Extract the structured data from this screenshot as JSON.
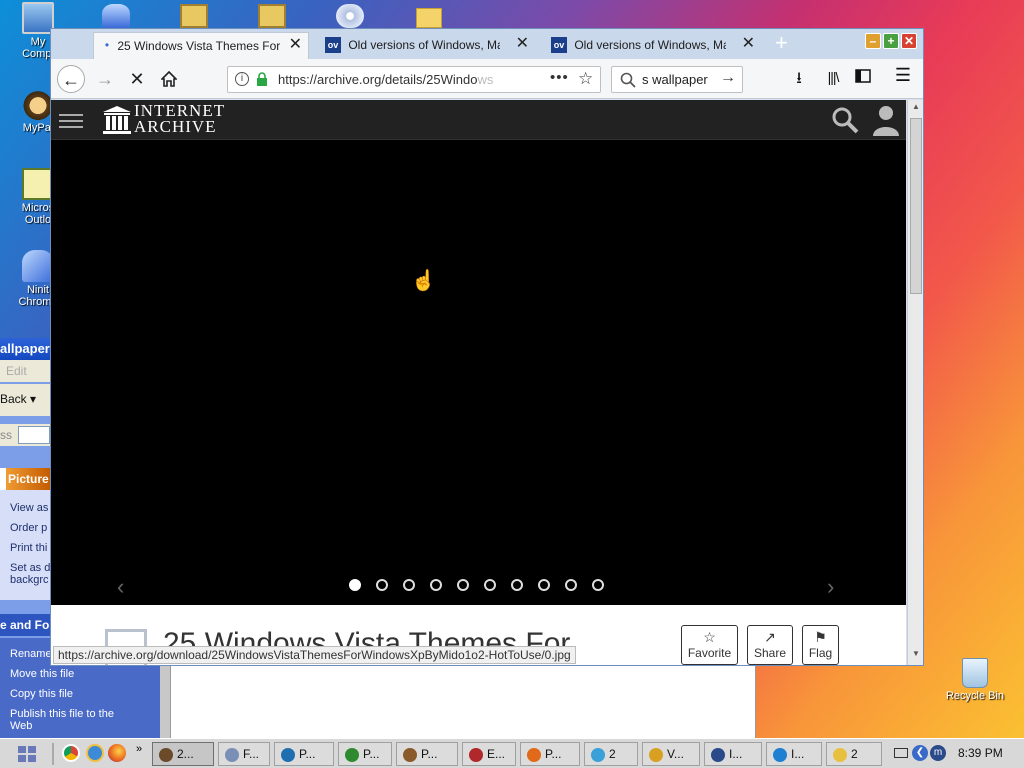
{
  "desktop": {
    "icons": [
      {
        "label": "My Compi",
        "name": "my-computer"
      },
      {
        "label": "MyPal",
        "name": "mypal"
      },
      {
        "label": "Micros Outlo",
        "name": "microsoft-outlook"
      },
      {
        "label": "Ninit Chrome",
        "name": "ninite-chrome"
      }
    ],
    "recycle_bin": "Recycle Bin"
  },
  "explorer": {
    "title": "allpaper",
    "menu_edit": "Edit",
    "back_label": "Back",
    "address_label": "ss",
    "picture_tasks_header": "Picture",
    "picture_tasks": [
      "View as",
      "Order p",
      "Print thi",
      "Set as d",
      "backgrc"
    ],
    "file_tasks_header": "e and Fo",
    "file_tasks": [
      "Rename",
      "Move this file",
      "Copy this file",
      "Publish this file to the",
      "Web"
    ]
  },
  "firefox": {
    "tabs": [
      {
        "title": "25 Windows Vista Themes For",
        "active": true
      },
      {
        "title": "Old versions of Windows, Ma",
        "active": false,
        "favicon": "ov"
      },
      {
        "title": "Old versions of Windows, Ma",
        "active": false,
        "favicon": "ov"
      }
    ],
    "new_tab": "+",
    "url": "https://archive.org/details/25Windo",
    "url_fade": "ws",
    "search_value": "s wallpaper",
    "status_url": "https://archive.org/download/25WindowsVistaThemesForWindowsXpByMido1o2-HotToUse/0.jpg"
  },
  "archive": {
    "logo_line1": "INTERNET",
    "logo_line2": "ARCHIVE",
    "carousel": {
      "total": 10,
      "current": 1
    },
    "item_title": "25 Windows Vista Themes For",
    "actions": [
      {
        "label": "Favorite",
        "icon": "star-icon",
        "glyph": "☆"
      },
      {
        "label": "Share",
        "icon": "share-icon",
        "glyph": "↗"
      },
      {
        "label": "Flag",
        "icon": "flag-icon",
        "glyph": "⚑"
      }
    ]
  },
  "taskbar": {
    "buttons": [
      {
        "label": "2...",
        "color": "#6b4a2a",
        "active": true
      },
      {
        "label": "F...",
        "color": "#7a8fb5"
      },
      {
        "label": "P...",
        "color": "#1f6fb0"
      },
      {
        "label": "P...",
        "color": "#2f8a2f"
      },
      {
        "label": "P...",
        "color": "#8a5a2a"
      },
      {
        "label": "E...",
        "color": "#b0282a"
      },
      {
        "label": "P...",
        "color": "#e06a1a"
      },
      {
        "label": "2",
        "color": "#3aa0d8"
      },
      {
        "label": "V...",
        "color": "#d8a020"
      },
      {
        "label": "I...",
        "color": "#2a4a8a"
      },
      {
        "label": "I...",
        "color": "#1f7fd0"
      },
      {
        "label": "2",
        "color": "#e8c040"
      }
    ],
    "clock": "8:39 PM"
  }
}
